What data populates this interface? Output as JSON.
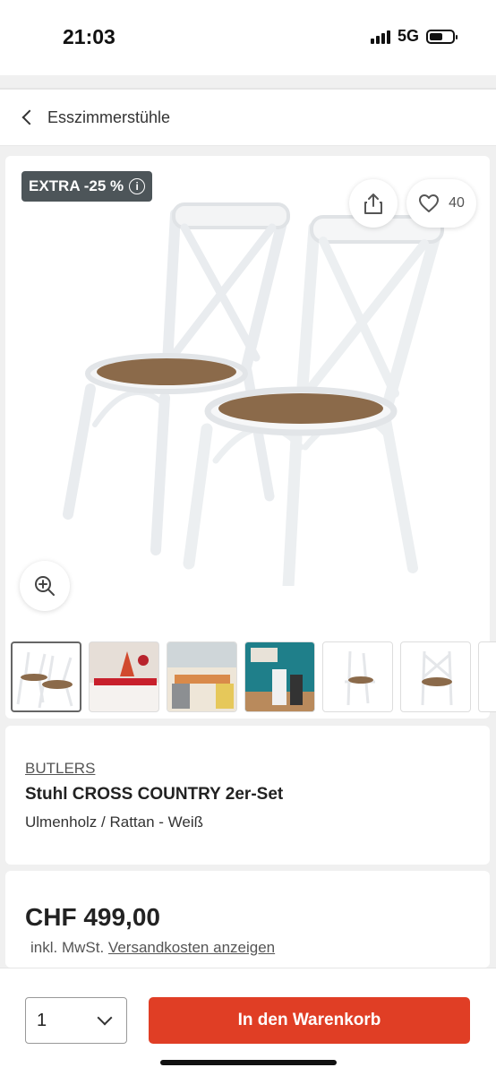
{
  "status_bar": {
    "time": "21:03",
    "network": "5G"
  },
  "nav": {
    "back_label": "Esszimmerstühle"
  },
  "product_image": {
    "badge": "EXTRA -25 %",
    "badge_info": "i",
    "wishlist_count": "40"
  },
  "thumbnails": [
    {
      "label": "chairs-front"
    },
    {
      "label": "christmas-table"
    },
    {
      "label": "dining-room"
    },
    {
      "label": "teal-wall-room"
    },
    {
      "label": "chair-side"
    },
    {
      "label": "chair-front-single"
    }
  ],
  "product": {
    "brand": "BUTLERS",
    "name": "Stuhl CROSS COUNTRY 2er-Set",
    "variant": "Ulmenholz / Rattan - Weiß"
  },
  "pricing": {
    "price": "CHF 499,00",
    "tax_prefix": "inkl. MwSt.",
    "shipping_link": "Versandkosten anzeigen"
  },
  "purchase": {
    "quantity": "1",
    "add_to_cart": "In den Warenkorb"
  },
  "colors": {
    "accent": "#e03e25",
    "badge_bg": "#4d5559"
  }
}
